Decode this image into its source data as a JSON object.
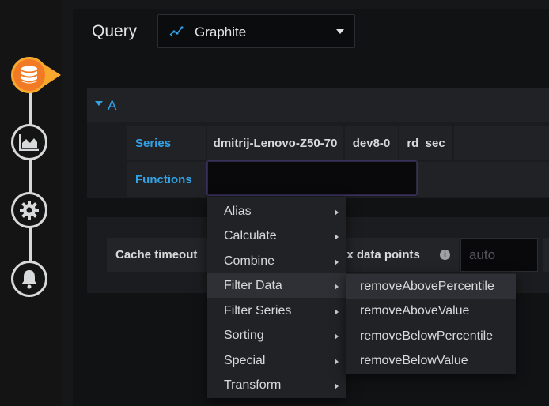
{
  "rail": {
    "steps": [
      {
        "name": "queries",
        "icon": "database-icon",
        "active": true
      },
      {
        "name": "visualization",
        "icon": "area-chart-icon",
        "active": false
      },
      {
        "name": "general",
        "icon": "gear-icon",
        "active": false
      },
      {
        "name": "alert",
        "icon": "bell-icon",
        "active": false
      }
    ],
    "active_color": "#f27a25"
  },
  "header": {
    "query_label": "Query",
    "datasource": "Graphite",
    "datasource_icon": "graphite-icon"
  },
  "target": {
    "ref_id": "A",
    "series_label": "Series",
    "series_segments": [
      "dmitrij-Lenovo-Z50-70",
      "dev8-0",
      "rd_sec"
    ],
    "functions_label": "Functions",
    "functions_value": ""
  },
  "options": {
    "cache_timeout_label": "Cache timeout",
    "max_data_points_label": "ax data points",
    "max_data_points_placeholder": "auto"
  },
  "function_menu": {
    "items": [
      "Alias",
      "Calculate",
      "Combine",
      "Filter Data",
      "Filter Series",
      "Sorting",
      "Special",
      "Transform"
    ],
    "hovered": "Filter Data",
    "submenu": {
      "items": [
        "removeAbovePercentile",
        "removeAboveValue",
        "removeBelowPercentile",
        "removeBelowValue"
      ],
      "hovered": "removeAbovePercentile"
    }
  },
  "colors": {
    "accent_blue": "#33a2e5",
    "background": "#161719",
    "panel": "#202226"
  }
}
